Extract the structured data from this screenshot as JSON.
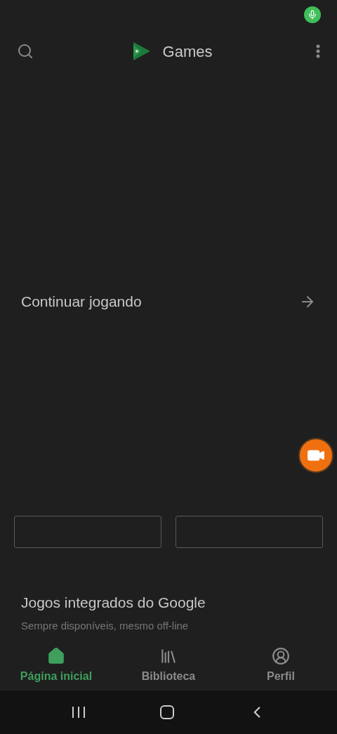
{
  "app_bar": {
    "title": "Games"
  },
  "continue_section": {
    "title": "Continuar jogando"
  },
  "cards": [
    {
      "kind": "empty"
    },
    {
      "kind": "empty"
    }
  ],
  "builtin_section": {
    "title": "Jogos integrados do Google",
    "subtitle": "Sempre disponíveis, mesmo off-line"
  },
  "bottom_nav": [
    {
      "label": "Página inicial",
      "selected": true,
      "kind": "home"
    },
    {
      "label": "Biblioteca",
      "selected": false,
      "kind": "library"
    },
    {
      "label": "Perfil",
      "selected": false,
      "kind": "profile"
    }
  ]
}
